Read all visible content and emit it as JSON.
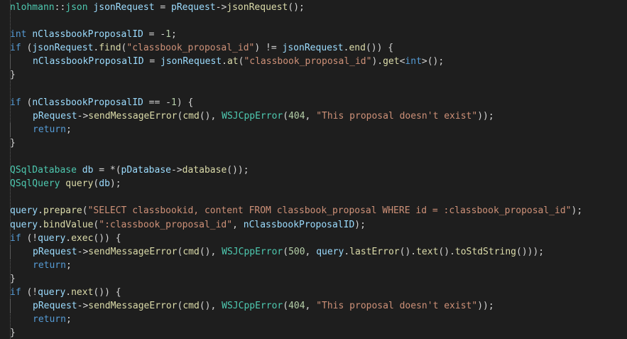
{
  "editor": {
    "lines": [
      [
        {
          "t": "nlohmann",
          "c": "ns"
        },
        {
          "t": "::",
          "c": "op"
        },
        {
          "t": "json",
          "c": "ty"
        },
        {
          "t": " ",
          "c": "op"
        },
        {
          "t": "jsonRequest",
          "c": "var"
        },
        {
          "t": " = ",
          "c": "op"
        },
        {
          "t": "pRequest",
          "c": "var"
        },
        {
          "t": "->",
          "c": "op"
        },
        {
          "t": "jsonRequest",
          "c": "fn"
        },
        {
          "t": "();",
          "c": "op"
        }
      ],
      [],
      [
        {
          "t": "int",
          "c": "kw"
        },
        {
          "t": " ",
          "c": "op"
        },
        {
          "t": "nClassbookProposalID",
          "c": "var"
        },
        {
          "t": " = -",
          "c": "op"
        },
        {
          "t": "1",
          "c": "num"
        },
        {
          "t": ";",
          "c": "op"
        }
      ],
      [
        {
          "t": "if",
          "c": "kw"
        },
        {
          "t": " (",
          "c": "op"
        },
        {
          "t": "jsonRequest",
          "c": "var"
        },
        {
          "t": ".",
          "c": "op"
        },
        {
          "t": "find",
          "c": "fn"
        },
        {
          "t": "(",
          "c": "op"
        },
        {
          "t": "\"classbook_proposal_id\"",
          "c": "str"
        },
        {
          "t": ") != ",
          "c": "op"
        },
        {
          "t": "jsonRequest",
          "c": "var"
        },
        {
          "t": ".",
          "c": "op"
        },
        {
          "t": "end",
          "c": "fn"
        },
        {
          "t": "()) {",
          "c": "op"
        }
      ],
      [
        {
          "ind": 1
        },
        {
          "t": "nClassbookProposalID",
          "c": "var"
        },
        {
          "t": " = ",
          "c": "op"
        },
        {
          "t": "jsonRequest",
          "c": "var"
        },
        {
          "t": ".",
          "c": "op"
        },
        {
          "t": "at",
          "c": "fn"
        },
        {
          "t": "(",
          "c": "op"
        },
        {
          "t": "\"classbook_proposal_id\"",
          "c": "str"
        },
        {
          "t": ").",
          "c": "op"
        },
        {
          "t": "get",
          "c": "fn"
        },
        {
          "t": "<",
          "c": "op"
        },
        {
          "t": "int",
          "c": "kw"
        },
        {
          "t": ">();",
          "c": "op"
        }
      ],
      [
        {
          "t": "}",
          "c": "op"
        }
      ],
      [],
      [
        {
          "t": "if",
          "c": "kw"
        },
        {
          "t": " (",
          "c": "op"
        },
        {
          "t": "nClassbookProposalID",
          "c": "var"
        },
        {
          "t": " == -",
          "c": "op"
        },
        {
          "t": "1",
          "c": "num"
        },
        {
          "t": ") {",
          "c": "op"
        }
      ],
      [
        {
          "ind": 1
        },
        {
          "t": "pRequest",
          "c": "var"
        },
        {
          "t": "->",
          "c": "op"
        },
        {
          "t": "sendMessageError",
          "c": "fn"
        },
        {
          "t": "(",
          "c": "op"
        },
        {
          "t": "cmd",
          "c": "fn"
        },
        {
          "t": "(), ",
          "c": "op"
        },
        {
          "t": "WSJCppError",
          "c": "cls"
        },
        {
          "t": "(",
          "c": "op"
        },
        {
          "t": "404",
          "c": "num"
        },
        {
          "t": ", ",
          "c": "op"
        },
        {
          "t": "\"This proposal doesn't exist\"",
          "c": "str"
        },
        {
          "t": "));",
          "c": "op"
        }
      ],
      [
        {
          "ind": 1
        },
        {
          "t": "return",
          "c": "kw"
        },
        {
          "t": ";",
          "c": "op"
        }
      ],
      [
        {
          "t": "}",
          "c": "op"
        }
      ],
      [],
      [
        {
          "t": "QSqlDatabase",
          "c": "ty"
        },
        {
          "t": " ",
          "c": "op"
        },
        {
          "t": "db",
          "c": "var"
        },
        {
          "t": " = *(",
          "c": "op"
        },
        {
          "t": "pDatabase",
          "c": "var"
        },
        {
          "t": "->",
          "c": "op"
        },
        {
          "t": "database",
          "c": "fn"
        },
        {
          "t": "());",
          "c": "op"
        }
      ],
      [
        {
          "t": "QSqlQuery",
          "c": "ty"
        },
        {
          "t": " ",
          "c": "op"
        },
        {
          "t": "query",
          "c": "fn"
        },
        {
          "t": "(",
          "c": "op"
        },
        {
          "t": "db",
          "c": "var"
        },
        {
          "t": ");",
          "c": "op"
        }
      ],
      [],
      [
        {
          "t": "query",
          "c": "var"
        },
        {
          "t": ".",
          "c": "op"
        },
        {
          "t": "prepare",
          "c": "fn"
        },
        {
          "t": "(",
          "c": "op"
        },
        {
          "t": "\"SELECT classbookid, content FROM classbook_proposal WHERE id = :classbook_proposal_id\"",
          "c": "str"
        },
        {
          "t": ");",
          "c": "op"
        }
      ],
      [
        {
          "t": "query",
          "c": "var"
        },
        {
          "t": ".",
          "c": "op"
        },
        {
          "t": "bindValue",
          "c": "fn"
        },
        {
          "t": "(",
          "c": "op"
        },
        {
          "t": "\":classbook_proposal_id\"",
          "c": "str"
        },
        {
          "t": ", ",
          "c": "op"
        },
        {
          "t": "nClassbookProposalID",
          "c": "var"
        },
        {
          "t": ");",
          "c": "op"
        }
      ],
      [
        {
          "t": "if",
          "c": "kw"
        },
        {
          "t": " (!",
          "c": "op"
        },
        {
          "t": "query",
          "c": "var"
        },
        {
          "t": ".",
          "c": "op"
        },
        {
          "t": "exec",
          "c": "fn"
        },
        {
          "t": "()) {",
          "c": "op"
        }
      ],
      [
        {
          "ind": 1
        },
        {
          "t": "pRequest",
          "c": "var"
        },
        {
          "t": "->",
          "c": "op"
        },
        {
          "t": "sendMessageError",
          "c": "fn"
        },
        {
          "t": "(",
          "c": "op"
        },
        {
          "t": "cmd",
          "c": "fn"
        },
        {
          "t": "(), ",
          "c": "op"
        },
        {
          "t": "WSJCppError",
          "c": "cls"
        },
        {
          "t": "(",
          "c": "op"
        },
        {
          "t": "500",
          "c": "num"
        },
        {
          "t": ", ",
          "c": "op"
        },
        {
          "t": "query",
          "c": "var"
        },
        {
          "t": ".",
          "c": "op"
        },
        {
          "t": "lastError",
          "c": "fn"
        },
        {
          "t": "().",
          "c": "op"
        },
        {
          "t": "text",
          "c": "fn"
        },
        {
          "t": "().",
          "c": "op"
        },
        {
          "t": "toStdString",
          "c": "fn"
        },
        {
          "t": "()));",
          "c": "op"
        }
      ],
      [
        {
          "ind": 1
        },
        {
          "t": "return",
          "c": "kw"
        },
        {
          "t": ";",
          "c": "op"
        }
      ],
      [
        {
          "t": "}",
          "c": "op"
        }
      ],
      [
        {
          "t": "if",
          "c": "kw"
        },
        {
          "t": " (!",
          "c": "op"
        },
        {
          "t": "query",
          "c": "var"
        },
        {
          "t": ".",
          "c": "op"
        },
        {
          "t": "next",
          "c": "fn"
        },
        {
          "t": "()) {",
          "c": "op"
        }
      ],
      [
        {
          "ind": 1
        },
        {
          "t": "pRequest",
          "c": "var"
        },
        {
          "t": "->",
          "c": "op"
        },
        {
          "t": "sendMessageError",
          "c": "fn"
        },
        {
          "t": "(",
          "c": "op"
        },
        {
          "t": "cmd",
          "c": "fn"
        },
        {
          "t": "(), ",
          "c": "op"
        },
        {
          "t": "WSJCppError",
          "c": "cls"
        },
        {
          "t": "(",
          "c": "op"
        },
        {
          "t": "404",
          "c": "num"
        },
        {
          "t": ", ",
          "c": "op"
        },
        {
          "t": "\"This proposal doesn't exist\"",
          "c": "str"
        },
        {
          "t": "));",
          "c": "op"
        }
      ],
      [
        {
          "ind": 1
        },
        {
          "t": "return",
          "c": "kw"
        },
        {
          "t": ";",
          "c": "op"
        }
      ],
      [
        {
          "t": "}",
          "c": "op"
        }
      ]
    ]
  },
  "colors": {
    "background": "#1e1e1e",
    "keyword": "#569cd6",
    "type": "#4ec9b0",
    "variable": "#9cdcfe",
    "function": "#dcdcaa",
    "string": "#ce9178",
    "number": "#b5cea8",
    "operator": "#d4d4d4"
  }
}
